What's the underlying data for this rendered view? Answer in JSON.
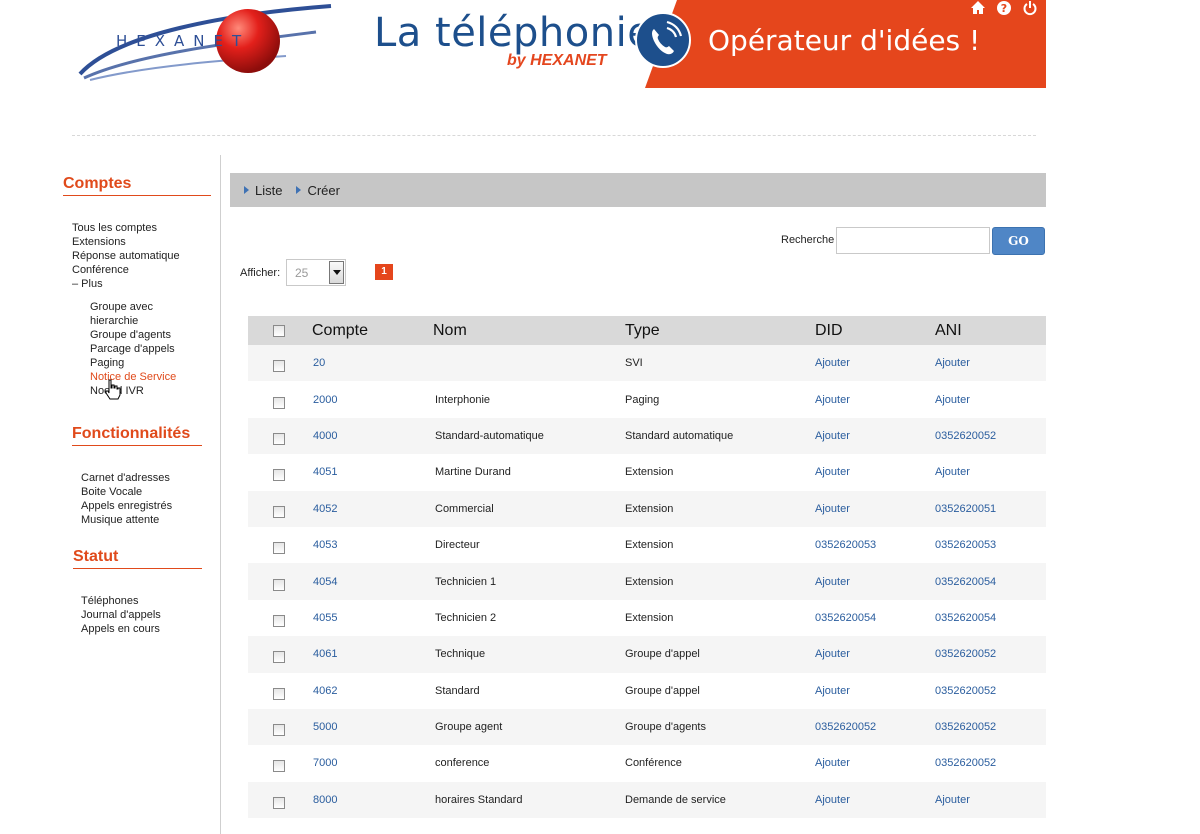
{
  "header": {
    "logo_text": "HEXANET",
    "banner_title": "La téléphonie",
    "banner_by": "by HEXANET",
    "banner_slogan": "Opérateur d'idées !",
    "top_icons": [
      "home-icon",
      "help-icon",
      "power-icon"
    ]
  },
  "sidebar": {
    "sections": [
      {
        "title": "Comptes",
        "items": [
          "Tous les comptes",
          "Extensions",
          "Réponse automatique",
          "Conférence",
          "– Plus"
        ],
        "subitems": [
          "Groupe avec hierarchie",
          "Groupe d'agents",
          "Parcage d'appels",
          "Paging",
          "Notice de Service",
          "Noeud IVR"
        ],
        "active_subitem": "Notice de Service"
      },
      {
        "title": "Fonctionnalités",
        "items": [
          "Carnet d'adresses",
          "Boite Vocale",
          "Appels enregistrés",
          "Musique attente"
        ]
      },
      {
        "title": "Statut",
        "items": [
          "Téléphones",
          "Journal d'appels",
          "Appels en cours"
        ]
      }
    ]
  },
  "tabs": [
    "Liste",
    "Créer"
  ],
  "search": {
    "label": "Recherche",
    "value": "",
    "button": "GO"
  },
  "pagination": {
    "show_label": "Afficher:",
    "per_page": "25",
    "current_page": "1"
  },
  "table": {
    "columns": [
      "Compte",
      "Nom",
      "Type",
      "DID",
      "ANI"
    ],
    "rows": [
      {
        "compte": "20",
        "nom": "",
        "type": "SVI",
        "did": "Ajouter",
        "ani": "Ajouter"
      },
      {
        "compte": "2000",
        "nom": "Interphonie",
        "type": "Paging",
        "did": "Ajouter",
        "ani": "Ajouter"
      },
      {
        "compte": "4000",
        "nom": "Standard-automatique",
        "type": "Standard automatique",
        "did": "Ajouter",
        "ani": "0352620052"
      },
      {
        "compte": "4051",
        "nom": "Martine Durand",
        "type": "Extension",
        "did": "Ajouter",
        "ani": "Ajouter"
      },
      {
        "compte": "4052",
        "nom": "Commercial",
        "type": "Extension",
        "did": "Ajouter",
        "ani": "0352620051"
      },
      {
        "compte": "4053",
        "nom": "Directeur",
        "type": "Extension",
        "did": "0352620053",
        "ani": "0352620053"
      },
      {
        "compte": "4054",
        "nom": "Technicien 1",
        "type": "Extension",
        "did": "Ajouter",
        "ani": "0352620054"
      },
      {
        "compte": "4055",
        "nom": "Technicien 2",
        "type": "Extension",
        "did": "0352620054",
        "ani": "0352620054"
      },
      {
        "compte": "4061",
        "nom": "Technique",
        "type": "Groupe d'appel",
        "did": "Ajouter",
        "ani": "0352620052"
      },
      {
        "compte": "4062",
        "nom": "Standard",
        "type": "Groupe d'appel",
        "did": "Ajouter",
        "ani": "0352620052"
      },
      {
        "compte": "5000",
        "nom": "Groupe agent",
        "type": "Groupe d'agents",
        "did": "0352620052",
        "ani": "0352620052"
      },
      {
        "compte": "7000",
        "nom": "conference",
        "type": "Conférence",
        "did": "Ajouter",
        "ani": "0352620052"
      },
      {
        "compte": "8000",
        "nom": "horaires Standard",
        "type": "Demande de service",
        "did": "Ajouter",
        "ani": "Ajouter"
      }
    ]
  },
  "colors": {
    "accent": "#e5461c",
    "brand_blue": "#1d4f8c",
    "link": "#2a5d9e",
    "go_button": "#4f86c6"
  }
}
